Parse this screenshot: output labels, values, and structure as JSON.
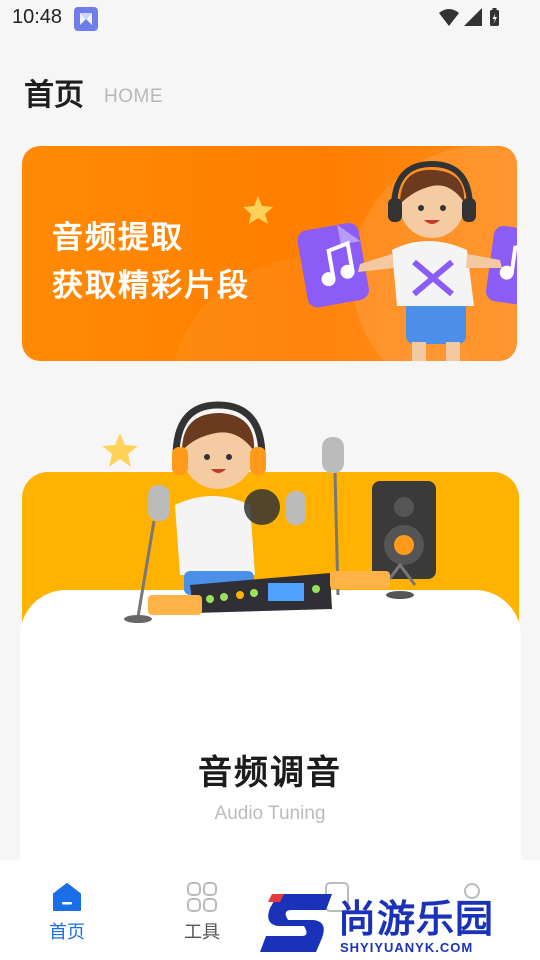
{
  "status_bar": {
    "time": "10:48",
    "icons": [
      "app-notification-icon",
      "wifi-icon",
      "signal-icon",
      "battery-icon"
    ]
  },
  "header": {
    "title": "首页",
    "subtitle": "HOME"
  },
  "banner": {
    "line1": "音频提取",
    "line2": "获取精彩片段",
    "colors": {
      "background": "#ff8000",
      "text": "#ffffff"
    }
  },
  "feature_card": {
    "title": "音频调音",
    "subtitle": "Audio Tuning",
    "colors": {
      "accent": "#ffb300",
      "card": "#ffffff"
    }
  },
  "bottom_nav": {
    "items": [
      {
        "label": "首页",
        "icon": "home-icon",
        "active": true
      },
      {
        "label": "工具",
        "icon": "grid-icon",
        "active": false
      },
      {
        "label": "",
        "icon": "doc-icon",
        "active": false
      },
      {
        "label": "",
        "icon": "user-icon",
        "active": false
      }
    ],
    "active_color": "#1a6fe8"
  },
  "watermark": {
    "logo_letter": "S",
    "text": "尚游乐园",
    "url": "SHYIYUANYK.COM"
  }
}
